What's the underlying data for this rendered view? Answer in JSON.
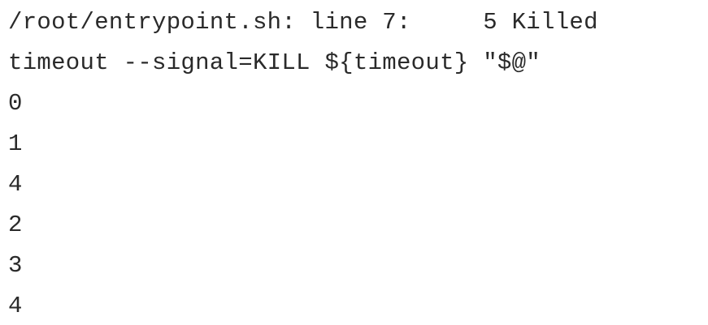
{
  "terminal": {
    "lines": [
      "/root/entrypoint.sh: line 7:     5 Killed",
      "timeout --signal=KILL ${timeout} \"$@\"",
      "0",
      "1",
      "4",
      "2",
      "3",
      "4"
    ]
  }
}
